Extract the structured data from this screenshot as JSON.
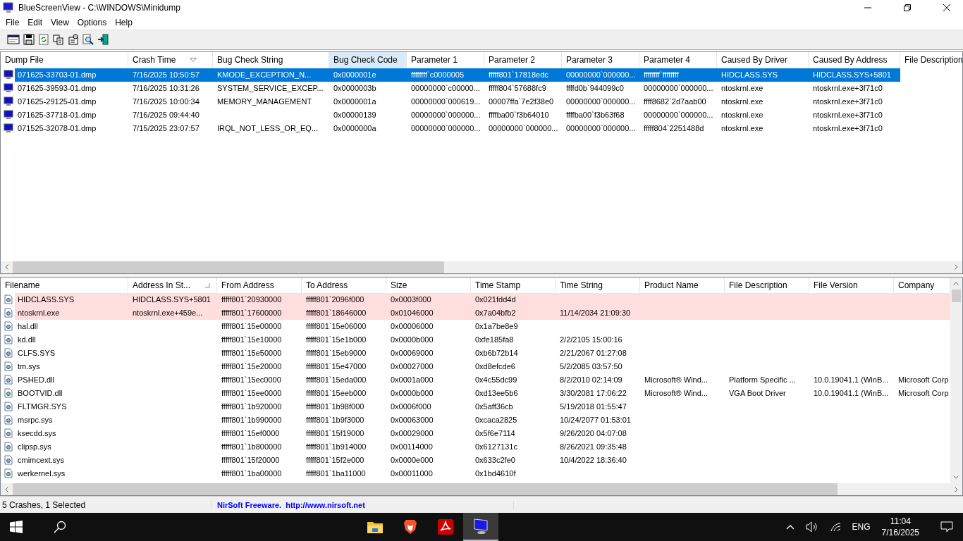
{
  "window": {
    "title": "BlueScreenView  -  C:\\WINDOWS\\Minidump"
  },
  "menu": [
    "File",
    "Edit",
    "View",
    "Options",
    "Help"
  ],
  "dumps": {
    "columns": [
      {
        "label": "Dump File",
        "sorted": false,
        "hot": false
      },
      {
        "label": "Crash Time",
        "sorted": true,
        "hot": false
      },
      {
        "label": "Bug Check String",
        "sorted": false,
        "hot": false
      },
      {
        "label": "Bug Check Code",
        "sorted": false,
        "hot": true
      },
      {
        "label": "Parameter 1",
        "sorted": false,
        "hot": false
      },
      {
        "label": "Parameter 2",
        "sorted": false,
        "hot": false
      },
      {
        "label": "Parameter 3",
        "sorted": false,
        "hot": false
      },
      {
        "label": "Parameter 4",
        "sorted": false,
        "hot": false
      },
      {
        "label": "Caused By Driver",
        "sorted": false,
        "hot": false
      },
      {
        "label": "Caused By Address",
        "sorted": false,
        "hot": false
      },
      {
        "label": "File Description",
        "sorted": false,
        "hot": false
      }
    ],
    "rows": [
      {
        "selected": true,
        "cells": [
          "071625-33703-01.dmp",
          "7/16/2025 10:50:57",
          "KMODE_EXCEPTION_N...",
          "0x0000001e",
          "ffffffff`c0000005",
          "fffff801`17818edc",
          "00000000`000000...",
          "ffffffff`ffffffff",
          "HIDCLASS.SYS",
          "HIDCLASS.SYS+5801"
        ]
      },
      {
        "selected": false,
        "cells": [
          "071625-39593-01.dmp",
          "7/16/2025 10:31:26",
          "SYSTEM_SERVICE_EXCEP...",
          "0x0000003b",
          "00000000`c00000...",
          "fffff804`57688fc9",
          "ffffd0b`944099c0",
          "00000000`000000...",
          "ntoskrnl.exe",
          "ntoskrnl.exe+3f71c0"
        ]
      },
      {
        "selected": false,
        "cells": [
          "071625-29125-01.dmp",
          "7/16/2025 10:00:34",
          "MEMORY_MANAGEMENT",
          "0x0000001a",
          "00000000`000619...",
          "00007ffa`7e2f38e0",
          "00000000`000000...",
          "ffff8682`2d7aab00",
          "ntoskrnl.exe",
          "ntoskrnl.exe+3f71c0"
        ]
      },
      {
        "selected": false,
        "cells": [
          "071625-37718-01.dmp",
          "7/16/2025 09:44:40",
          "",
          "0x00000139",
          "00000000`000000...",
          "ffffba00`f3b64010",
          "ffffba00`f3b63f68",
          "00000000`000000...",
          "ntoskrnl.exe",
          "ntoskrnl.exe+3f71c0"
        ]
      },
      {
        "selected": false,
        "cells": [
          "071525-32078-01.dmp",
          "7/15/2025 23:07:57",
          "IRQL_NOT_LESS_OR_EQ...",
          "0x0000000a",
          "00000000`000000...",
          "00000000`000000...",
          "00000000`000000...",
          "fffff804`2251488d",
          "ntoskrnl.exe",
          "ntoskrnl.exe+3f71c0"
        ]
      }
    ]
  },
  "drivers": {
    "columns": [
      {
        "label": "Filename",
        "sorted": false,
        "hot": false
      },
      {
        "label": "Address In St...",
        "sorted": true,
        "hot": false
      },
      {
        "label": "From Address",
        "sorted": false,
        "hot": false
      },
      {
        "label": "To Address",
        "sorted": false,
        "hot": false
      },
      {
        "label": "Size",
        "sorted": false,
        "hot": false
      },
      {
        "label": "Time Stamp",
        "sorted": false,
        "hot": false
      },
      {
        "label": "Time String",
        "sorted": false,
        "hot": false
      },
      {
        "label": "Product Name",
        "sorted": false,
        "hot": false
      },
      {
        "label": "File Description",
        "sorted": false,
        "hot": false
      },
      {
        "label": "File Version",
        "sorted": false,
        "hot": false
      },
      {
        "label": "Company",
        "sorted": false,
        "hot": false
      }
    ],
    "rows": [
      {
        "highlighted": true,
        "cells": [
          "HIDCLASS.SYS",
          "HIDCLASS.SYS+5801",
          "fffff801`20930000",
          "fffff801`2096f000",
          "0x0003f000",
          "0x021fdd4d",
          "",
          "",
          "",
          "",
          ""
        ]
      },
      {
        "highlighted": true,
        "cells": [
          "ntoskrnl.exe",
          "ntoskrnl.exe+459e...",
          "fffff801`17600000",
          "fffff801`18646000",
          "0x01046000",
          "0x7a04bfb2",
          "11/14/2034 21:09:30",
          "",
          "",
          "",
          ""
        ]
      },
      {
        "highlighted": false,
        "cells": [
          "hal.dll",
          "",
          "fffff801`15e00000",
          "fffff801`15e06000",
          "0x00006000",
          "0x1a7be8e9",
          "",
          "",
          "",
          "",
          ""
        ]
      },
      {
        "highlighted": false,
        "cells": [
          "kd.dll",
          "",
          "fffff801`15e10000",
          "fffff801`15e1b000",
          "0x0000b000",
          "0xfe185fa8",
          "2/2/2105 15:00:16",
          "",
          "",
          "",
          ""
        ]
      },
      {
        "highlighted": false,
        "cells": [
          "CLFS.SYS",
          "",
          "fffff801`15e50000",
          "fffff801`15eb9000",
          "0x00069000",
          "0xb6b72b14",
          "2/21/2067 01:27:08",
          "",
          "",
          "",
          ""
        ]
      },
      {
        "highlighted": false,
        "cells": [
          "tm.sys",
          "",
          "fffff801`15e20000",
          "fffff801`15e47000",
          "0x00027000",
          "0xd8efcde6",
          "5/2/2085 03:57:50",
          "",
          "",
          "",
          ""
        ]
      },
      {
        "highlighted": false,
        "cells": [
          "PSHED.dll",
          "",
          "fffff801`15ec0000",
          "fffff801`15eda000",
          "0x0001a000",
          "0x4c55dc99",
          "8/2/2010 02:14:09",
          "Microsoft® Wind...",
          "Platform Specific ...",
          "10.0.19041.1 (WinB...",
          "Microsoft Corp"
        ]
      },
      {
        "highlighted": false,
        "cells": [
          "BOOTVID.dll",
          "",
          "fffff801`15ee0000",
          "fffff801`15eeb000",
          "0x0000b000",
          "0xd13ee5b6",
          "3/30/2081 17:06:22",
          "Microsoft® Wind...",
          "VGA Boot Driver",
          "10.0.19041.1 (WinB...",
          "Microsoft Corp"
        ]
      },
      {
        "highlighted": false,
        "cells": [
          "FLTMGR.SYS",
          "",
          "fffff801`1b920000",
          "fffff801`1b98f000",
          "0x0006f000",
          "0x5aff36cb",
          "5/19/2018 01:55:47",
          "",
          "",
          "",
          ""
        ]
      },
      {
        "highlighted": false,
        "cells": [
          "msrpc.sys",
          "",
          "fffff801`1b990000",
          "fffff801`1b9f3000",
          "0x00063000",
          "0xcaca2825",
          "10/24/2077 01:53:01",
          "",
          "",
          "",
          ""
        ]
      },
      {
        "highlighted": false,
        "cells": [
          "ksecdd.sys",
          "",
          "fffff801`15ef0000",
          "fffff801`15f19000",
          "0x00029000",
          "0x5f6e7114",
          "9/26/2020 04:07:08",
          "",
          "",
          "",
          ""
        ]
      },
      {
        "highlighted": false,
        "cells": [
          "clipsp.sys",
          "",
          "fffff801`1b800000",
          "fffff801`1b914000",
          "0x00114000",
          "0x6127131c",
          "8/26/2021 09:35:48",
          "",
          "",
          "",
          ""
        ]
      },
      {
        "highlighted": false,
        "cells": [
          "cmimcext.sys",
          "",
          "fffff801`15f20000",
          "fffff801`15f2e000",
          "0x0000e000",
          "0x633c2fe0",
          "10/4/2022 18:36:40",
          "",
          "",
          "",
          ""
        ]
      },
      {
        "highlighted": false,
        "cells": [
          "werkernel.sys",
          "",
          "fffff801`1ba00000",
          "fffff801`1ba11000",
          "0x00011000",
          "0x1bd4610f",
          "",
          "",
          "",
          "",
          ""
        ]
      }
    ]
  },
  "status_bar": {
    "summary": "5 Crashes, 1 Selected",
    "credit": "NirSoft Freeware.  http://www.nirsoft.net"
  },
  "taskbar": {
    "apps": [
      {
        "kind": "folder",
        "active": false
      },
      {
        "kind": "browser",
        "active": false
      },
      {
        "kind": "pdf",
        "active": false
      },
      {
        "kind": "monitor",
        "active": true
      }
    ],
    "language": "ENG",
    "time": "11:04",
    "date": "7/16/2025"
  }
}
